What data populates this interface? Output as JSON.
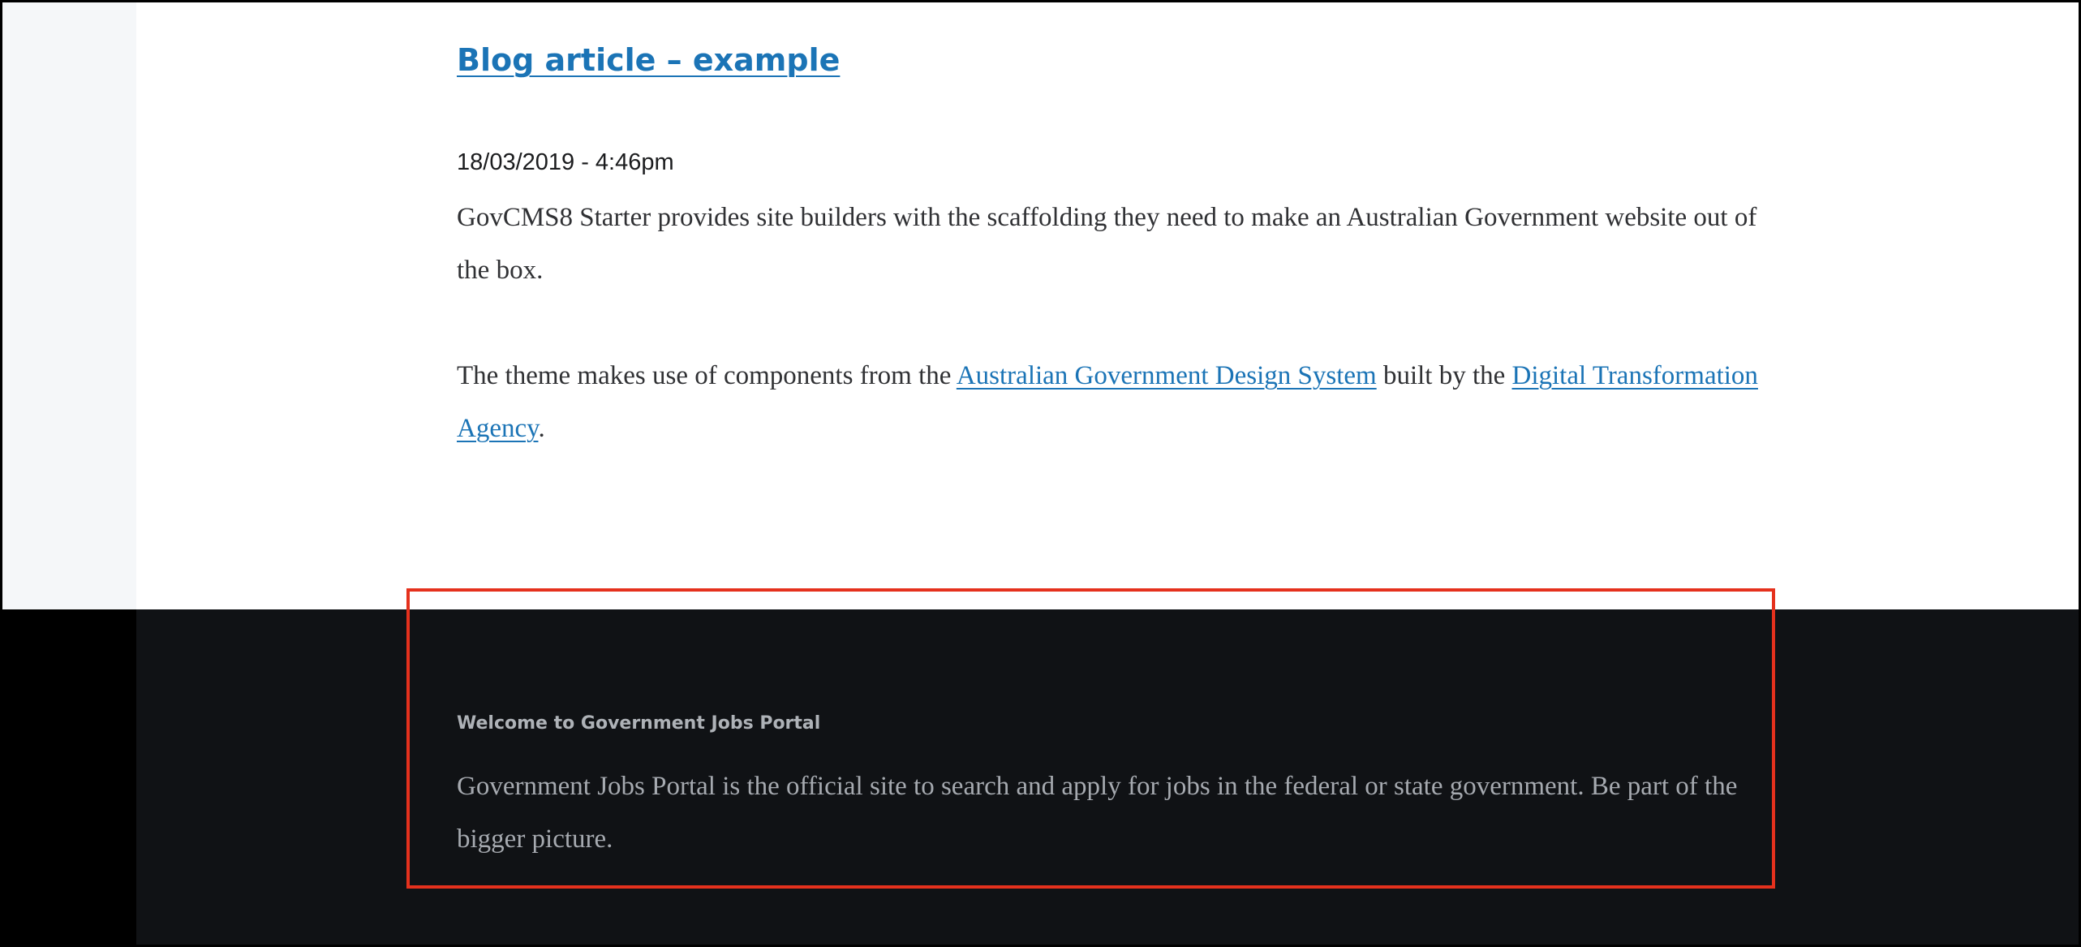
{
  "article": {
    "title": "Blog article – example",
    "date": "18/03/2019 - 4:46pm",
    "paragraph1": "GovCMS8 Starter provides site builders with the scaffolding they need to make an Australian Government website out of the box.",
    "paragraph2_prefix": "The theme makes use of components from the ",
    "link1_label": "Australian Government Design System",
    "paragraph2_middle": " built by the ",
    "link2_label": "Digital Transformation Agency",
    "paragraph2_suffix": "."
  },
  "footer": {
    "heading": "Welcome to Government Jobs Portal",
    "text": "Government Jobs Portal is the official site to search and apply for jobs in the federal or state government. Be part of the bigger picture."
  },
  "colors": {
    "link": "#1b74b6",
    "footer_background": "#101215",
    "highlight": "#e5311d"
  }
}
